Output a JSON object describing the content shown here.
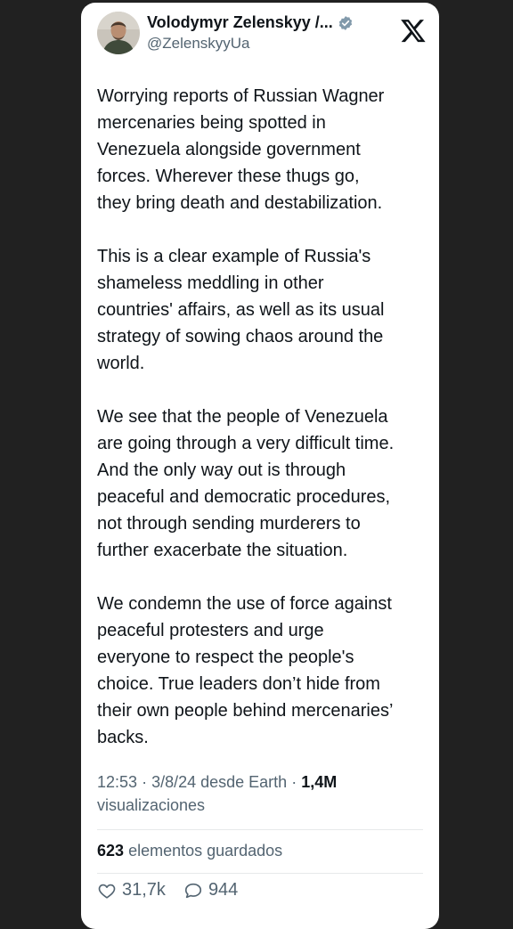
{
  "author": {
    "display_name": "Volodymyr Zelenskyy /...",
    "handle": "@ZelenskyyUa"
  },
  "tweet": {
    "paragraphs": [
      "Worrying reports of Russian Wagner\nmercenaries being spotted in\nVenezuela alongside government\nforces. Wherever these thugs go,\nthey bring death and destabilization.",
      "This is a clear example of Russia's\nshameless meddling in other\ncountries' affairs, as well as its usual\nstrategy of sowing chaos around the\nworld.",
      "We see that the people of Venezuela\nare going through a very difficult time.\nAnd the only way out is through\npeaceful and democratic procedures,\nnot through sending murderers to\nfurther exacerbate the situation.",
      "We condemn the use of force against\npeaceful protesters and urge\neveryone to respect the people's\nchoice. True leaders don’t hide from\ntheir own people behind mercenaries’\nbacks."
    ],
    "time": "12:53",
    "date": "3/8/24 desde Earth",
    "views_count": "1,4M",
    "views_label": "visualizaciones",
    "bookmarks_count": "623",
    "bookmarks_label": "elementos guardados",
    "likes": "31,7k",
    "replies": "944"
  },
  "icons": {
    "verified": "verified-badge-icon",
    "logo": "x-logo-icon",
    "like": "heart-icon",
    "reply": "comment-icon"
  },
  "colors": {
    "background": "#212121",
    "card": "#ffffff",
    "text_primary": "#0f1419",
    "text_secondary": "#536471",
    "verified": "#829aab"
  }
}
